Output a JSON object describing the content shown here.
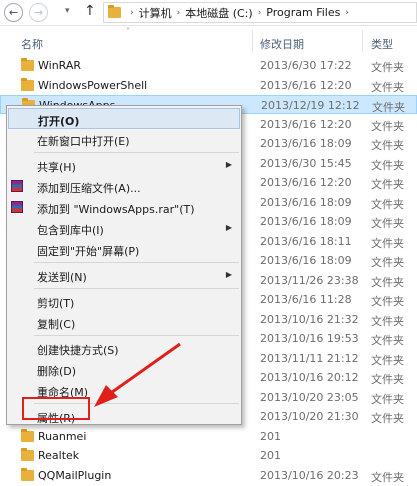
{
  "address": {
    "back_glyph": "←",
    "fwd_glyph": "→",
    "dropdown_glyph": "▾",
    "up_glyph": "↑",
    "crumbs": [
      "计算机",
      "本地磁盘 (C:)",
      "Program Files"
    ],
    "sep": "›"
  },
  "columns": {
    "name": "名称",
    "date": "修改日期",
    "type": "类型"
  },
  "files": [
    {
      "name": "WinRAR",
      "date": "2013/6/30 17:22",
      "type": "文件夹"
    },
    {
      "name": "WindowsPowerShell",
      "date": "2013/6/16 12:20",
      "type": "文件夹"
    },
    {
      "name": "WindowsApps",
      "date": "2013/12/19 12:12",
      "type": "文件夹",
      "selected": true
    },
    {
      "name": "",
      "date": "2013/6/16 12:20",
      "type": "文件夹"
    },
    {
      "name": "",
      "date": "2013/6/16 18:09",
      "type": "文件夹"
    },
    {
      "name": "",
      "date": "2013/6/30 15:45",
      "type": "文件夹"
    },
    {
      "name": "",
      "date": "2013/6/16 12:20",
      "type": "文件夹"
    },
    {
      "name": "",
      "date": "2013/6/16 18:09",
      "type": "文件夹"
    },
    {
      "name": "",
      "date": "2013/6/16 18:09",
      "type": "文件夹"
    },
    {
      "name": "",
      "date": "2013/6/16 18:11",
      "type": "文件夹"
    },
    {
      "name": "",
      "date": "2013/6/16 18:09",
      "type": "文件夹"
    },
    {
      "name": "",
      "date": "2013/11/26 23:38",
      "type": "文件夹"
    },
    {
      "name": "",
      "date": "2013/6/16 11:28",
      "type": "文件夹"
    },
    {
      "name": "",
      "date": "2013/10/16 21:32",
      "type": "文件夹"
    },
    {
      "name": "",
      "date": "2013/10/16 19:53",
      "type": "文件夹"
    },
    {
      "name": "",
      "date": "2013/11/11 21:12",
      "type": "文件夹"
    },
    {
      "name": "",
      "date": "2013/10/16 20:12",
      "type": "文件夹"
    },
    {
      "name": "",
      "date": "2013/10/20 23:05",
      "type": "文件夹"
    },
    {
      "name": "",
      "date": "2013/10/20 21:30",
      "type": "文件夹"
    },
    {
      "name": "Ruanmei",
      "date": "201",
      "type": ""
    },
    {
      "name": "Realtek",
      "date": "201",
      "type": ""
    },
    {
      "name": "QQMailPlugin",
      "date": "2013/10/16 20:23",
      "type": "文件夹"
    }
  ],
  "menu": {
    "items": [
      {
        "label": "打开(O)",
        "bold": true,
        "highlight": true
      },
      {
        "label": "在新窗口中打开(E)"
      },
      {
        "sep": true
      },
      {
        "label": "共享(H)",
        "submenu": true
      },
      {
        "label": "添加到压缩文件(A)...",
        "icon": "winrar-icon"
      },
      {
        "label": "添加到 \"WindowsApps.rar\"(T)",
        "icon": "winrar-icon"
      },
      {
        "label": "包含到库中(I)",
        "submenu": true
      },
      {
        "label": "固定到\"开始\"屏幕(P)"
      },
      {
        "sep": true
      },
      {
        "label": "发送到(N)",
        "submenu": true
      },
      {
        "sep": true
      },
      {
        "label": "剪切(T)"
      },
      {
        "label": "复制(C)"
      },
      {
        "sep": true
      },
      {
        "label": "创建快捷方式(S)"
      },
      {
        "label": "删除(D)"
      },
      {
        "label": "重命名(M)"
      },
      {
        "sep": true
      },
      {
        "label": "属性(R)"
      }
    ],
    "submenu_glyph": "▶"
  },
  "colors": {
    "selection": "#cce8ff",
    "annotation": "#e0201b",
    "folder": "#e8b13b"
  },
  "annotation": {
    "target": "属性(R)"
  }
}
